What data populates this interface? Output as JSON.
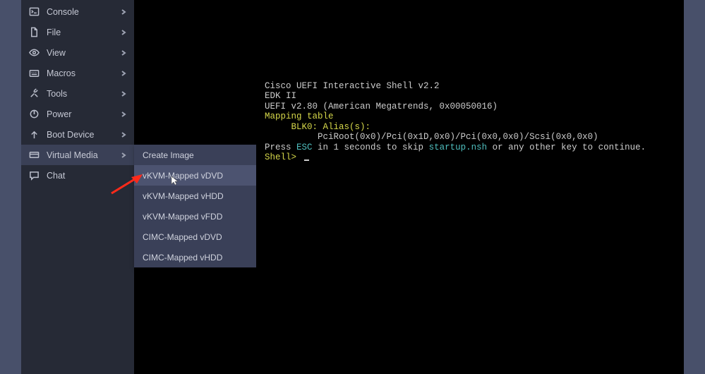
{
  "sidebar": {
    "items": [
      {
        "label": "Console",
        "icon": "console-icon"
      },
      {
        "label": "File",
        "icon": "file-icon"
      },
      {
        "label": "View",
        "icon": "view-icon"
      },
      {
        "label": "Macros",
        "icon": "macros-icon"
      },
      {
        "label": "Tools",
        "icon": "tools-icon"
      },
      {
        "label": "Power",
        "icon": "power-icon"
      },
      {
        "label": "Boot Device",
        "icon": "boot-icon"
      },
      {
        "label": "Virtual Media",
        "icon": "vmedia-icon"
      },
      {
        "label": "Chat",
        "icon": "chat-icon"
      }
    ]
  },
  "submenu": {
    "items": [
      {
        "label": "Create Image"
      },
      {
        "label": "vKVM-Mapped vDVD"
      },
      {
        "label": "vKVM-Mapped vHDD"
      },
      {
        "label": "vKVM-Mapped vFDD"
      },
      {
        "label": "CIMC-Mapped vDVD"
      },
      {
        "label": "CIMC-Mapped vHDD"
      }
    ]
  },
  "console": {
    "line1": "Cisco UEFI Interactive Shell v2.2",
    "line2": "EDK II",
    "line3": "UEFI v2.80 (American Megatrends, 0x00050016)",
    "mapping_table": "Mapping table",
    "blk0": "BLK0:",
    "aliases": "Alias(s):",
    "pciroot": "PciRoot(0x0)/Pci(0x1D,0x0)/Pci(0x0,0x0)/Scsi(0x0,0x0)",
    "press": "Press ",
    "esc": "ESC",
    "press_tail_a": " in 1 seconds to skip ",
    "startup": "startup.nsh",
    "press_tail_b": " or any other key to continue.",
    "shell_prompt": "Shell> "
  }
}
